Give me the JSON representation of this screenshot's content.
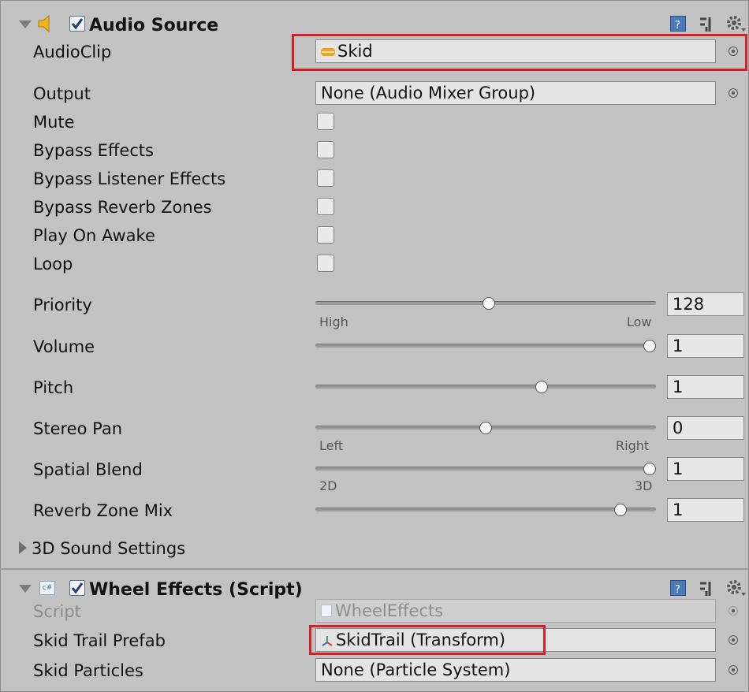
{
  "audio_source": {
    "title": "Audio Source",
    "enabled": true,
    "fields": {
      "audioclip": {
        "label": "AudioClip",
        "value": "Skid"
      },
      "output": {
        "label": "Output",
        "value": "None (Audio Mixer Group)"
      }
    },
    "toggles": [
      {
        "label": "Mute",
        "checked": false
      },
      {
        "label": "Bypass Effects",
        "checked": false
      },
      {
        "label": "Bypass Listener Effects",
        "checked": false
      },
      {
        "label": "Bypass Reverb Zones",
        "checked": false
      },
      {
        "label": "Play On Awake",
        "checked": false
      },
      {
        "label": "Loop",
        "checked": false
      }
    ],
    "sliders": {
      "priority": {
        "label": "Priority",
        "value": "128",
        "fraction": 0.51,
        "min_label": "High",
        "max_label": "Low"
      },
      "volume": {
        "label": "Volume",
        "value": "1",
        "fraction": 1.0
      },
      "pitch": {
        "label": "Pitch",
        "value": "1",
        "fraction": 0.67
      },
      "stereo_pan": {
        "label": "Stereo Pan",
        "value": "0",
        "fraction": 0.5,
        "min_label": "Left",
        "max_label": "Right"
      },
      "spatial_blend": {
        "label": "Spatial Blend",
        "value": "1",
        "fraction": 1.0,
        "min_label": "2D",
        "max_label": "3D"
      },
      "reverb_zone_mix": {
        "label": "Reverb Zone Mix",
        "value": "1",
        "fraction": 0.91
      }
    },
    "foldout_3d": "3D Sound Settings"
  },
  "wheel_effects": {
    "title": "Wheel Effects (Script)",
    "enabled": true,
    "fields": {
      "script": {
        "label": "Script",
        "value": "WheelEffects"
      },
      "skid_trail_prefab": {
        "label": "Skid Trail Prefab",
        "value": "SkidTrail (Transform)"
      },
      "skid_particles": {
        "label": "Skid Particles",
        "value": "None (Particle System)"
      }
    }
  },
  "colors": {
    "highlight": "#d31f25",
    "panel": "#c2c2c2",
    "audio_icon": "#f2b21a"
  },
  "icons": [
    "foldout-arrow-icon",
    "speaker-icon",
    "checkbox-icon",
    "help-book-icon",
    "preset-sliders-icon",
    "gear-icon",
    "audio-clip-icon",
    "object-picker-icon",
    "csharp-script-icon",
    "transform-icon"
  ]
}
